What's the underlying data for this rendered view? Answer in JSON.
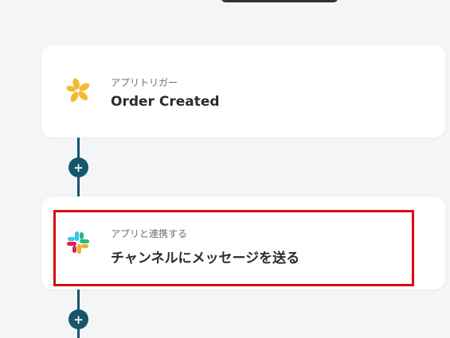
{
  "colors": {
    "background": "#f4f5f7",
    "card": "#ffffff",
    "connector": "#16566c",
    "highlight": "#d90c0c",
    "trigger_icon": "#f5b82e"
  },
  "flow": {
    "steps": [
      {
        "category": "アプリトリガー",
        "title": "Order Created",
        "icon": "star-flower-icon"
      },
      {
        "category": "アプリと連携する",
        "title": "チャンネルにメッセージを送る",
        "icon": "slack-icon"
      }
    ],
    "add_buttons": [
      "+",
      "+"
    ]
  }
}
